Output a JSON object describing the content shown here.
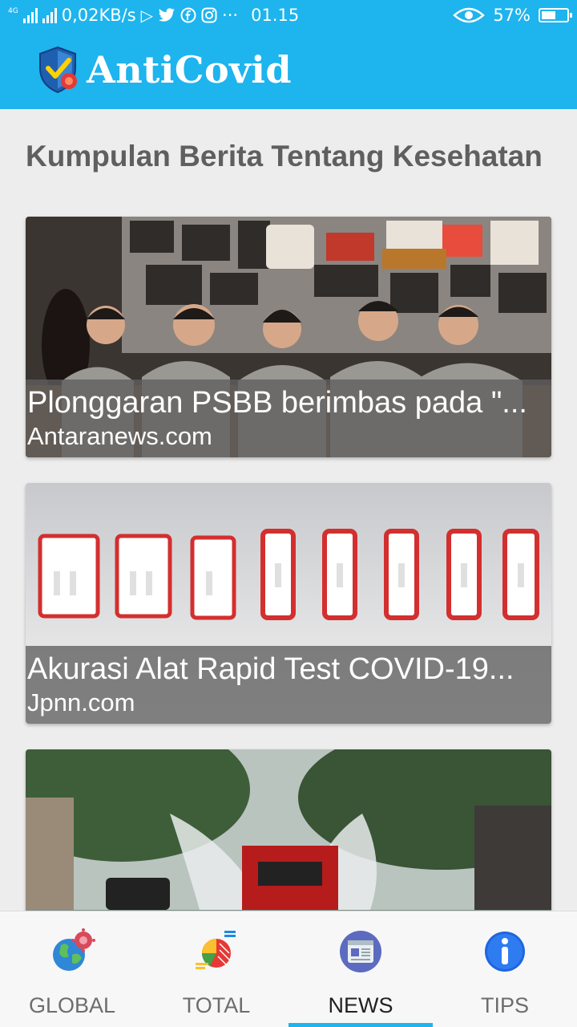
{
  "status_bar": {
    "network": "4G",
    "data_rate": "0,02KB/s",
    "more": "···",
    "time": "01.15",
    "battery_percent": "57%",
    "battery_level": 0.57,
    "notification_icons": [
      "play-store-icon",
      "twitter-icon",
      "facebook-icon",
      "instagram-icon"
    ]
  },
  "app_bar": {
    "title": "AntiCovid",
    "background_color": "#1eb4ee"
  },
  "content": {
    "section_title": "Kumpulan Berita Tentang Kesehatan",
    "articles": [
      {
        "title": "Plonggaran PSBB berimbas pada \"...",
        "source": "Antaranews.com"
      },
      {
        "title": "Akurasi Alat Rapid Test COVID-19...",
        "source": "Jpnn.com"
      },
      {
        "title": "",
        "source": ""
      }
    ]
  },
  "bottom_nav": {
    "items": [
      {
        "label": "GLOBAL",
        "icon": "globe-virus-icon",
        "active": false
      },
      {
        "label": "TOTAL",
        "icon": "chart-icon",
        "active": false
      },
      {
        "label": "NEWS",
        "icon": "newspaper-icon",
        "active": true
      },
      {
        "label": "TIPS",
        "icon": "info-icon",
        "active": false
      }
    ],
    "accent_color": "#1eb4ee"
  }
}
